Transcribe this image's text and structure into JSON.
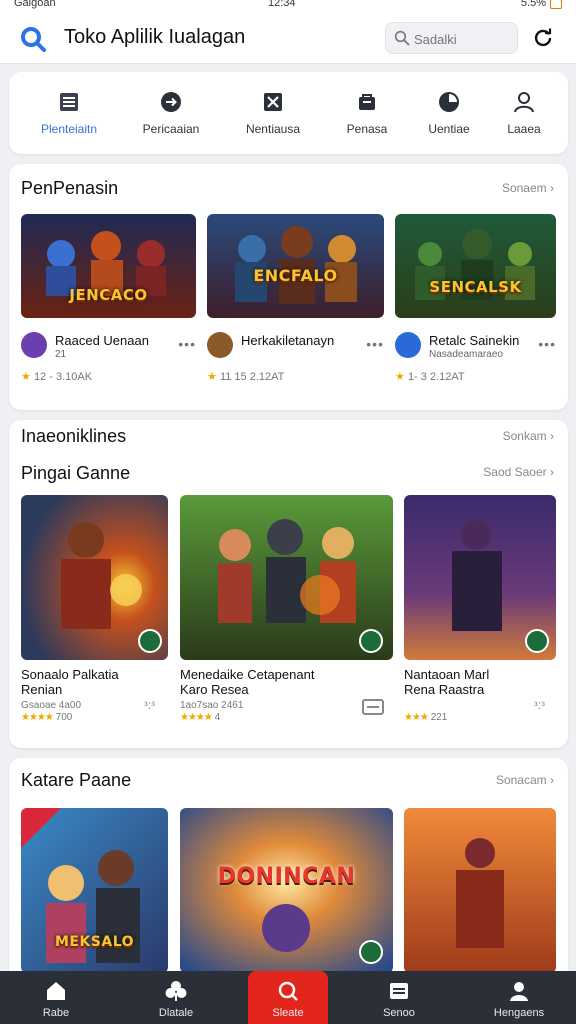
{
  "status_bar": {
    "carrier": "Gaigoan",
    "time": "12:34",
    "battery": "5.5%"
  },
  "header": {
    "title": "Toko Aplilik Iualagan",
    "search_placeholder": "Sadalki"
  },
  "categories": [
    {
      "label": "Plenteiaitn",
      "icon": "list-icon",
      "active": true
    },
    {
      "label": "Pericaaian",
      "icon": "arrow-circle-icon",
      "active": false
    },
    {
      "label": "Nentiausa",
      "icon": "tools-icon",
      "active": false
    },
    {
      "label": "Penasa",
      "icon": "bag-icon",
      "active": false
    },
    {
      "label": "Uentiae",
      "icon": "pie-icon",
      "active": false
    },
    {
      "label": "Laaea",
      "icon": "person-icon",
      "active": false
    }
  ],
  "section1": {
    "title": "PenPenasin",
    "link": "Sonaem",
    "items": [
      {
        "art": "JENCACO",
        "name": "Raaced Uenaan",
        "sub": "21",
        "rating": "12 - 3.10AK"
      },
      {
        "art": "ENCFALO",
        "name": "Herkakiletanayn",
        "sub": "",
        "rating": "11 15 2.12AT"
      },
      {
        "art": "SENCALSK",
        "name": "Retalc Sainekin",
        "sub": "Nasadeamaraeo",
        "rating": "1- 3 2.12AT"
      }
    ]
  },
  "section2": {
    "title": "Inaeoniklines",
    "link": "Sonkam",
    "subtitle": "Pingai Ganne",
    "sublink": "Saod Saoer",
    "items": [
      {
        "name_line1": "Sonaalo Palkatia",
        "name_line2": "Renian",
        "meta": "Gsaoae 4a00",
        "stars": "★★★★",
        "meta2": "700",
        "side": "ᵌ:ᵌ"
      },
      {
        "name_line1": "Menedaike Cetapenant",
        "name_line2": "Karo Resea",
        "meta": "1ao7sao 2461",
        "stars": "★★★★",
        "meta2": "4",
        "side": ""
      },
      {
        "name_line1": "Nantaoan Marl",
        "name_line2": "Rena Raastra",
        "meta": "",
        "stars": "★★★",
        "meta2": "221",
        "side": "ᵌ:ᵌ"
      }
    ]
  },
  "section3": {
    "title": "Katare Paane",
    "link": "Sonacam",
    "items": [
      {
        "art": "MEKSALO"
      },
      {
        "art": "DONINCAN"
      },
      {
        "art": ""
      }
    ]
  },
  "bottom_nav": [
    {
      "label": "Rabe",
      "icon": "home-icon",
      "active": false
    },
    {
      "label": "Dlatale",
      "icon": "clubs-icon",
      "active": false
    },
    {
      "label": "Sleate",
      "icon": "search-icon",
      "active": true
    },
    {
      "label": "Senoo",
      "icon": "menu-icon",
      "active": false
    },
    {
      "label": "Hengaens",
      "icon": "person-icon",
      "active": false
    }
  ],
  "colors": {
    "accent": "#3a6fd8",
    "nav_bg": "#2b2f38",
    "nav_active": "#e3261c",
    "star": "#f0a800"
  }
}
